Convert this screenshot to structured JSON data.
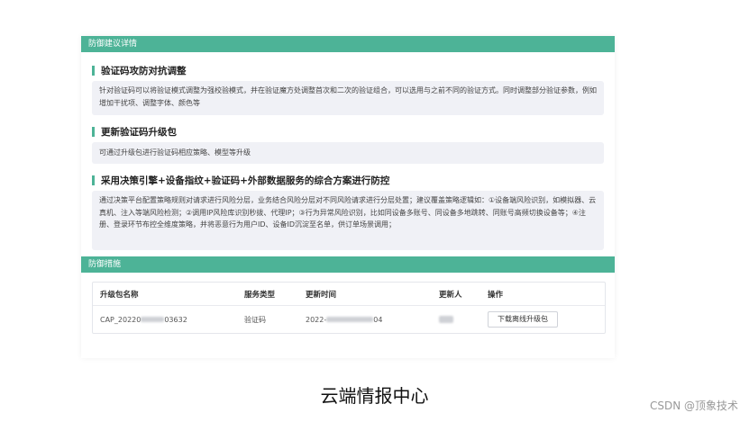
{
  "panel": {
    "suggestion_header": "防御建议详情",
    "measures_header": "防御措施"
  },
  "suggestions": [
    {
      "title": "验证码攻防对抗调整",
      "body": "针对验证码可以将验证模式调整为强校验模式，并在验证魔方处调整首次和二次的验证组合，可以选用与之前不同的验证方式。同时调整部分验证参数，例如增加干扰项、调整字体、颜色等"
    },
    {
      "title": "更新验证码升级包",
      "body": "可通过升级包进行验证码相应策略、模型等升级"
    },
    {
      "title": "采用决策引擎+设备指纹+验证码+外部数据服务的综合方案进行防控",
      "body": "通过决策平台配置策略规则对请求进行风险分层，业务结合风险分层对不同风险请求进行分层处置；建议覆盖策略逻辑如：①设备端风险识别，如模拟器、云真机、注入等端风险检测；②调用IP风险库识别秒拨、代理IP；③行为异常风险识别，比如同设备多账号、同设备多地跳转、同账号高频切换设备等；④注册、登录环节布控全维度策略，并将恶意行为用户ID、设备ID沉淀至名单，供订单场景调用；"
    }
  ],
  "table": {
    "headers": [
      "升级包名称",
      "服务类型",
      "更新时间",
      "更新人",
      "操作"
    ],
    "rows": [
      {
        "name_prefix": "CAP_20220",
        "name_suffix": "03632",
        "service": "验证码",
        "time_prefix": "2022-",
        "time_suffix": "04",
        "action": "下载离线升级包"
      }
    ]
  },
  "caption": "云端情报中心",
  "watermark": "CSDN @顶象技术",
  "colors": {
    "accent": "#4db397",
    "box_bg": "#f0f1f6"
  }
}
